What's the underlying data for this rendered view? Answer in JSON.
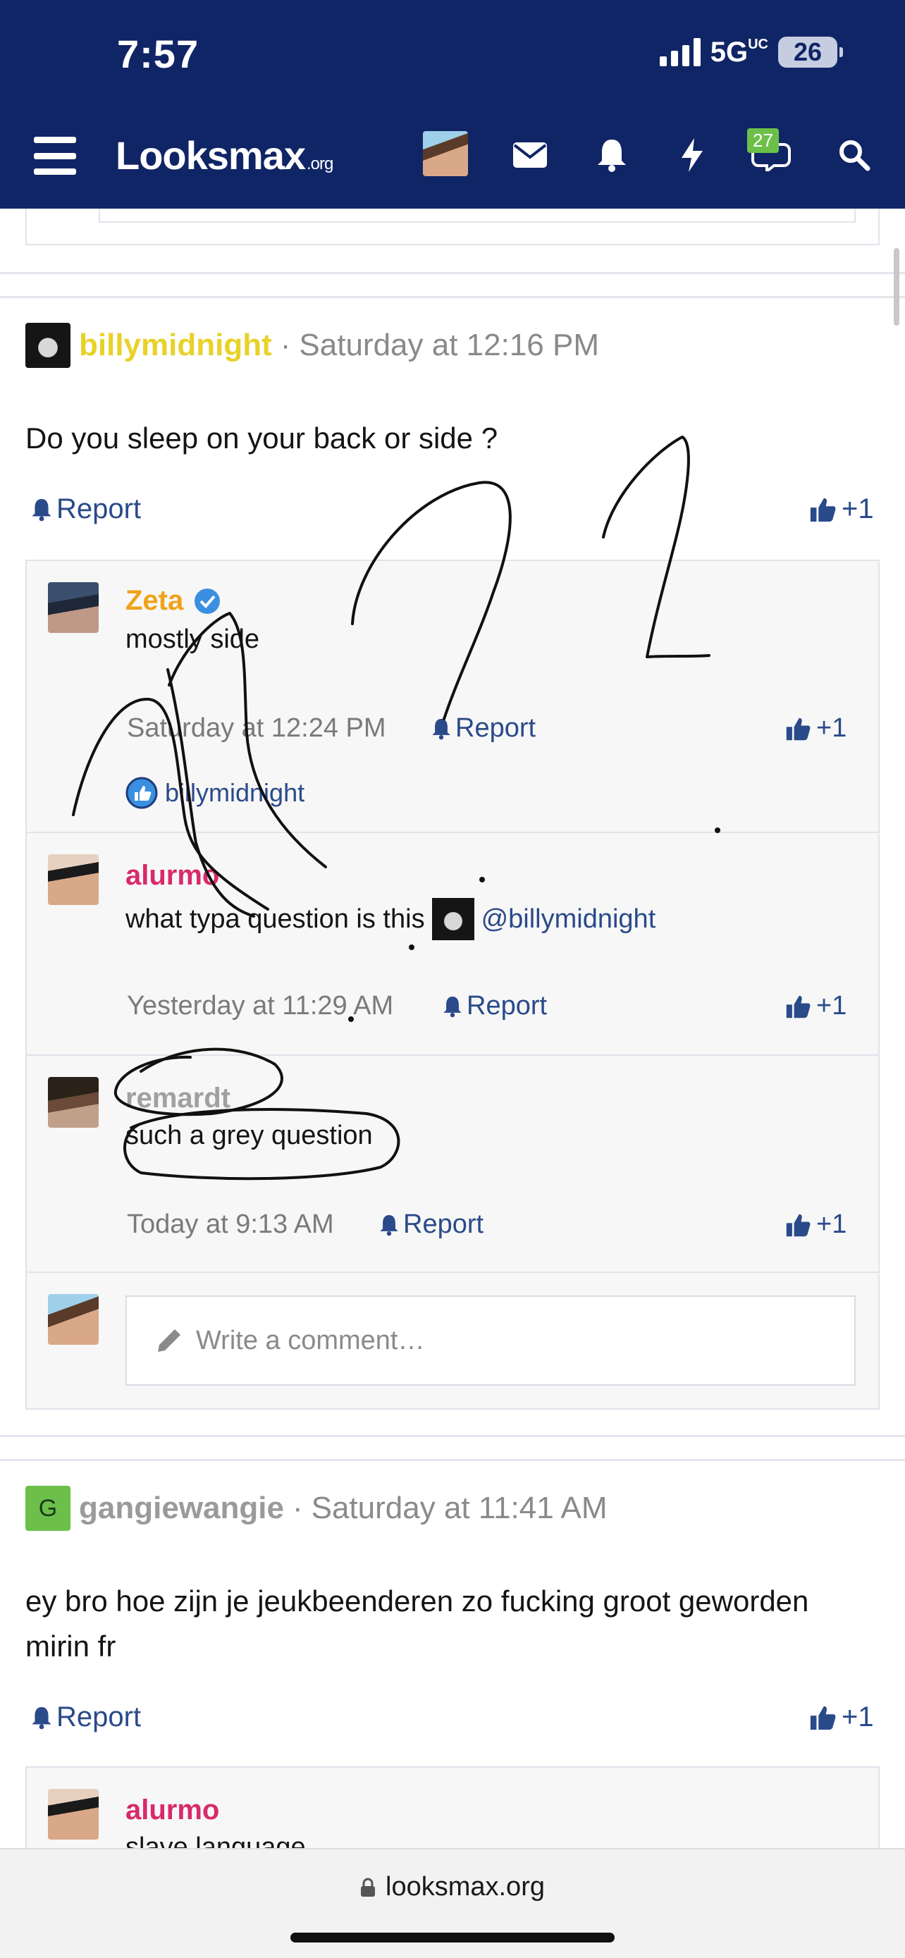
{
  "status_bar": {
    "time": "7:57",
    "network": "5G",
    "network_sup": "UC",
    "battery": "26"
  },
  "nav": {
    "logo_main": "Looksmax",
    "logo_suffix": ".org",
    "chat_badge": "27"
  },
  "posts": [
    {
      "username": "billymidnight",
      "username_color": "#e8d22a",
      "separator": "·",
      "timestamp": "Saturday at 12:16 PM",
      "body": "Do you sleep on your back or side ?",
      "report": "Report",
      "like": "+1",
      "comments": [
        {
          "name": "Zeta",
          "name_color": "#f0a21a",
          "verified": true,
          "text": "mostly side",
          "time": "Saturday at 12:24 PM",
          "report": "Report",
          "like": "+1",
          "liked_by": "billymidnight"
        },
        {
          "name": "alurmo",
          "name_color": "#d82a6a",
          "text": "what typa question is this",
          "mention": "@billymidnight",
          "time": "Yesterday at 11:29 AM",
          "report": "Report",
          "like": "+1"
        },
        {
          "name": "remardt",
          "name_color": "#a0a0a0",
          "text": "such a grey question",
          "time": "Today at 9:13 AM",
          "report": "Report",
          "like": "+1"
        }
      ],
      "write_placeholder": "Write a comment…"
    },
    {
      "avatar_letter": "G",
      "avatar_color": "#6cc04a",
      "username": "gangiewangie",
      "username_color": "#9a9a9a",
      "separator": "·",
      "timestamp": "Saturday at 11:41 AM",
      "body": "ey bro hoe zijn je jeukbeenderen zo fucking groot geworden mirin fr",
      "report": "Report",
      "like": "+1",
      "comments": [
        {
          "name": "alurmo",
          "name_color": "#d82a6a",
          "text": "slave language"
        }
      ]
    }
  ],
  "browser": {
    "url": "looksmax.org"
  },
  "colors": {
    "header": "#102565",
    "link": "#2a4a8a",
    "like_blue": "#3b8fe0"
  }
}
